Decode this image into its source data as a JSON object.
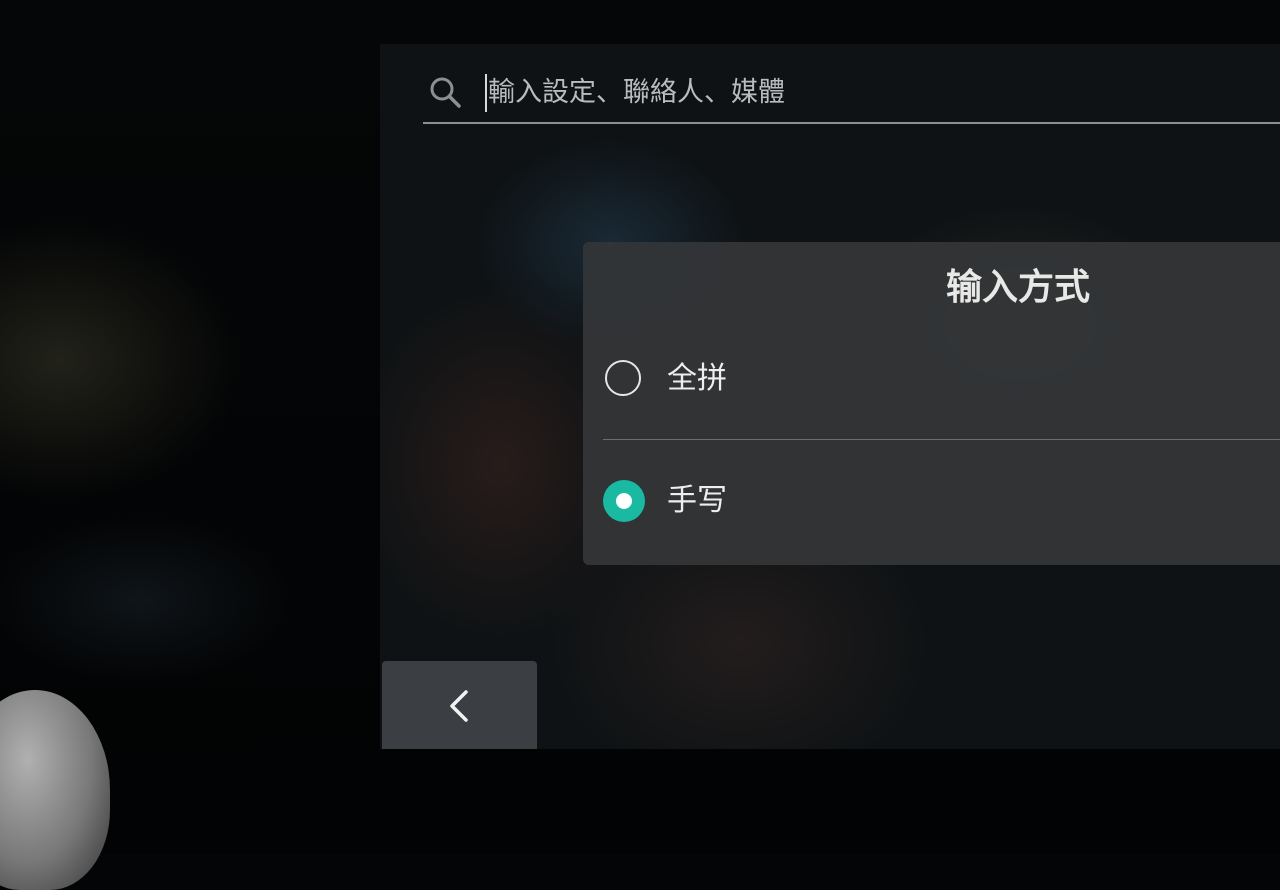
{
  "search": {
    "placeholder": "輸入設定、聯絡人、媒體",
    "icon": "search-icon"
  },
  "dialog": {
    "title": "输入方式",
    "options": [
      {
        "label": "全拼",
        "selected": false
      },
      {
        "label": "手写",
        "selected": true
      }
    ]
  },
  "navigation": {
    "back_icon": "chevron-left-icon"
  },
  "colors": {
    "accent": "#19b9a2",
    "dialog_background": "#343638"
  }
}
